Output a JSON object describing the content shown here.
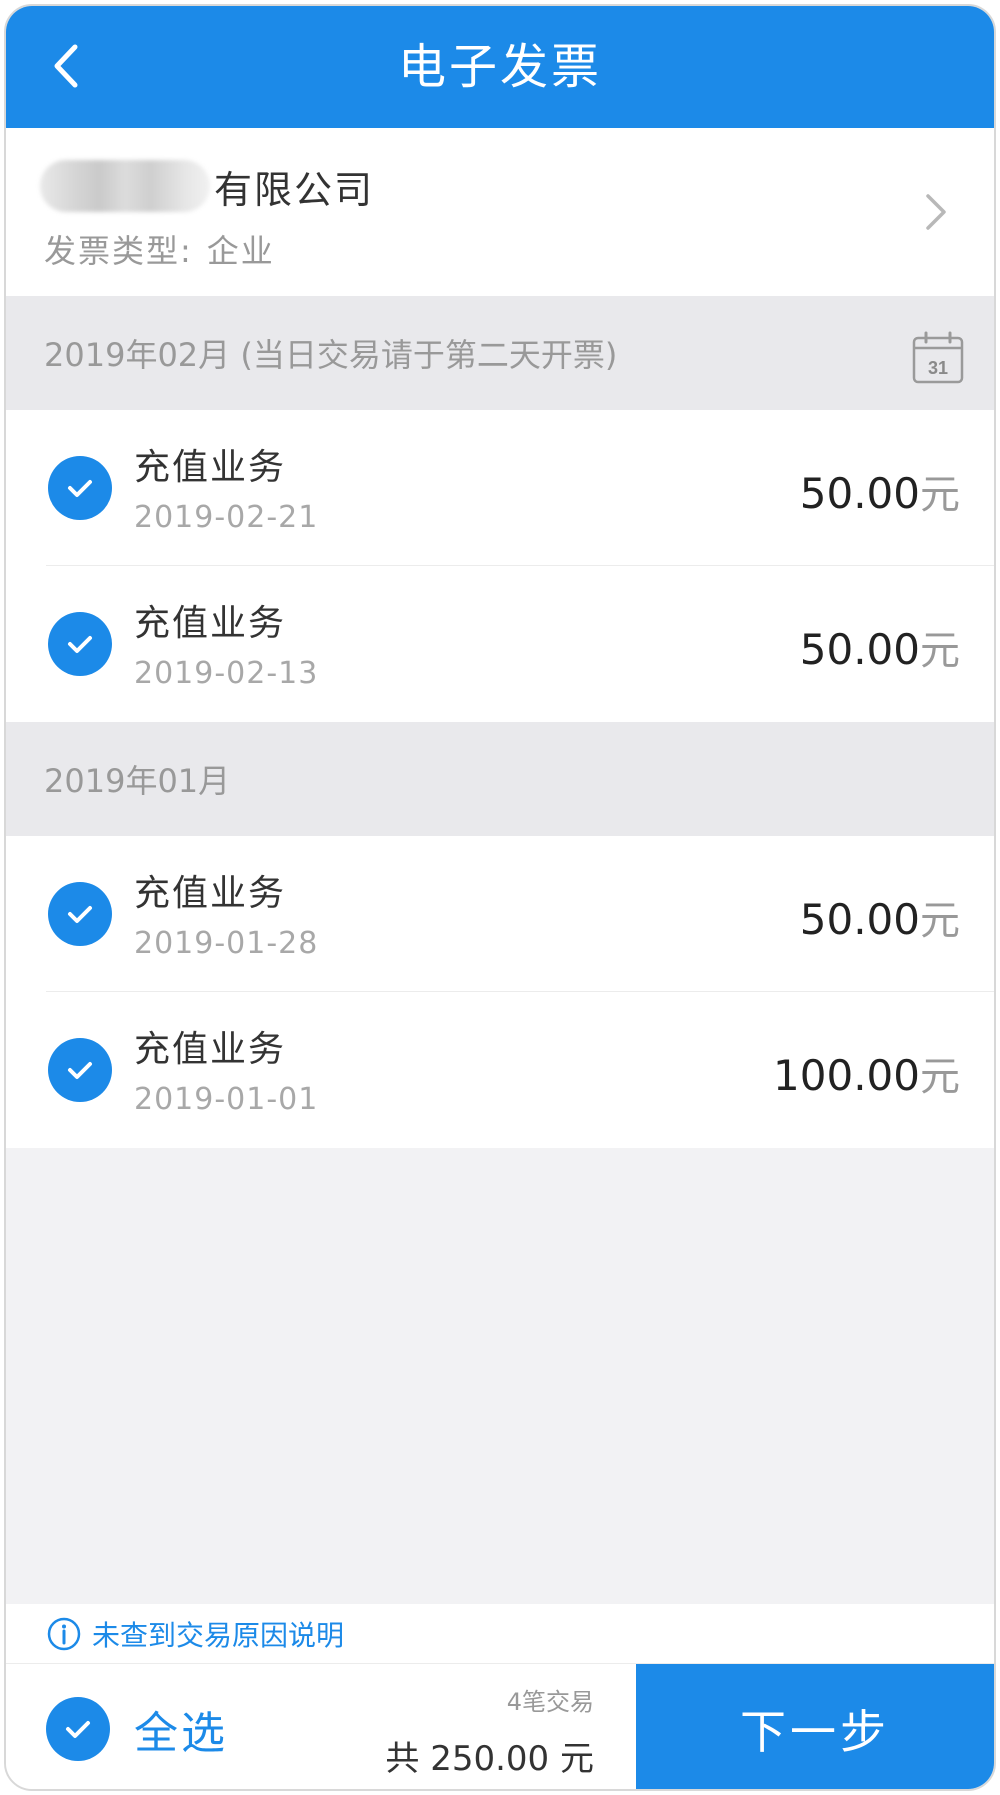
{
  "header": {
    "title": "电子发票"
  },
  "company": {
    "name_suffix": "有限公司",
    "type_label": "发票类型:",
    "type_value": "企业"
  },
  "months": [
    {
      "label": "2019年02月 (当日交易请于第二天开票)",
      "calendar_day": "31",
      "items": [
        {
          "title": "充值业务",
          "date": "2019-02-21",
          "amount": "50.00",
          "unit": "元"
        },
        {
          "title": "充值业务",
          "date": "2019-02-13",
          "amount": "50.00",
          "unit": "元"
        }
      ]
    },
    {
      "label": "2019年01月",
      "items": [
        {
          "title": "充值业务",
          "date": "2019-01-28",
          "amount": "50.00",
          "unit": "元"
        },
        {
          "title": "充值业务",
          "date": "2019-01-01",
          "amount": "100.00",
          "unit": "元"
        }
      ]
    }
  ],
  "note": {
    "text": "未查到交易原因说明"
  },
  "footer": {
    "select_all": "全选",
    "count_text": "4笔交易",
    "total_text": "共 250.00 元",
    "next_label": "下一步"
  },
  "colors": {
    "accent": "#1c8ae8",
    "background": "#f2f2f4"
  }
}
